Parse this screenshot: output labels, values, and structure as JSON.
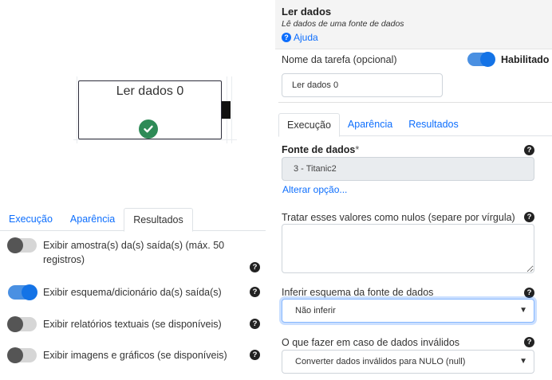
{
  "canvas": {
    "node_title": "Ler dados 0",
    "node_status_icon": "check-circle-icon",
    "status_color": "#2e8b57"
  },
  "left_panel": {
    "tabs": [
      {
        "label": "Execução",
        "active": false
      },
      {
        "label": "Aparência",
        "active": false
      },
      {
        "label": "Resultados",
        "active": true
      }
    ],
    "toggles": [
      {
        "label": "Exibir amostra(s) da(s) saída(s) (máx. 50 registros)",
        "on": false
      },
      {
        "label": "Exibir esquema/dicionário da(s) saída(s)",
        "on": true
      },
      {
        "label": "Exibir relatórios textuais (se disponíveis)",
        "on": false
      },
      {
        "label": "Exibir imagens e gráficos (se disponíveis)",
        "on": false
      }
    ]
  },
  "right_panel": {
    "title": "Ler dados",
    "subtitle": "Lê dados de uma fonte de dados",
    "help_label": "Ajuda",
    "task_name_label": "Nome da tarefa (opcional)",
    "enabled_label": "Habilitado",
    "enabled": true,
    "task_name_value": "Ler dados 0",
    "tabs": [
      {
        "label": "Execução",
        "active": true
      },
      {
        "label": "Aparência",
        "active": false
      },
      {
        "label": "Resultados",
        "active": false
      }
    ],
    "source_label": "Fonte de dados",
    "source_required_mark": "*",
    "source_value": "3 - Titanic2",
    "change_option_label": "Alterar opção...",
    "nulls_label": "Tratar esses valores como nulos (separe por vírgula)",
    "nulls_value": "",
    "infer_label": "Inferir esquema da fonte de dados",
    "infer_value": "Não inferir",
    "invalid_label": "O que fazer em caso de dados inválidos",
    "invalid_value": "Converter dados inválidos para NULO (null)",
    "help_glyph": "?",
    "caret_glyph": "▼"
  },
  "colors": {
    "accent": "#0d6efd",
    "toggle_on": "#1473e6",
    "header_bg": "#f4f4f4"
  }
}
